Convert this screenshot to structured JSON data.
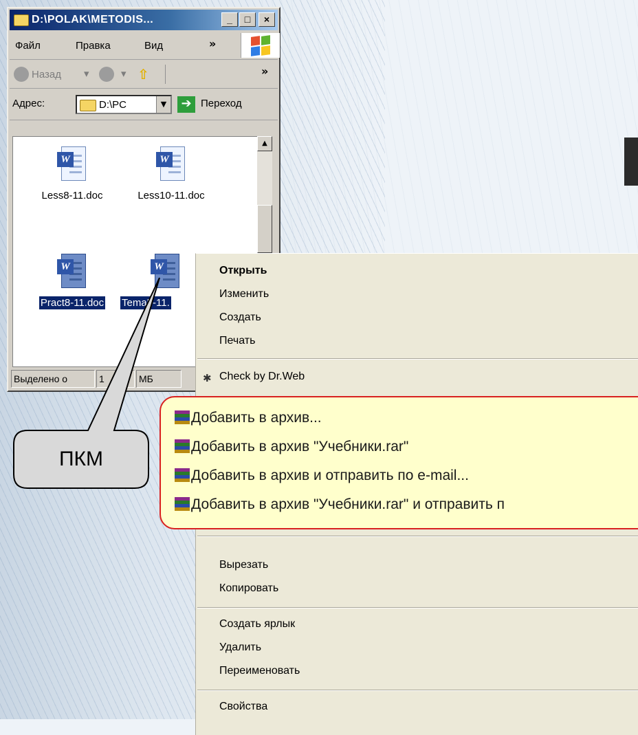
{
  "window": {
    "title": "D:\\POLAK\\METODIS...",
    "menu": [
      "Файл",
      "Правка",
      "Вид"
    ],
    "menu_more": "»",
    "toolbar_back": "Назад",
    "toolbar_more": "»",
    "address_label": "Адрес:",
    "address_value": "D:\\PC",
    "go_label": "Переход",
    "files": [
      {
        "name": "Less8-11.doc",
        "selected": false
      },
      {
        "name": "Less10-11.doc",
        "selected": false
      },
      {
        "name": "Pract8-11.doc",
        "selected": true
      },
      {
        "name": "Tema5-11.",
        "selected": true
      }
    ],
    "status_selected": "Выделено о",
    "status_size_partial": "1",
    "status_size_unit": "МБ",
    "minimize": "_",
    "maximize": "□",
    "close": "×"
  },
  "context_menu": {
    "items_top": [
      "Открыть",
      "Изменить",
      "Создать",
      "Печать"
    ],
    "drweb": "Check by Dr.Web",
    "rar_items": [
      "Добавить в архив...",
      "Добавить в архив \"Учебники.rar\"",
      "Добавить в архив и отправить по e-mail...",
      "Добавить в архив \"Учебники.rar\" и отправить п"
    ],
    "items_edit": [
      "Вырезать",
      "Копировать"
    ],
    "items_file": [
      "Создать ярлык",
      "Удалить",
      "Переименовать"
    ],
    "properties": "Свойства"
  },
  "callout": {
    "label": "ПКМ"
  },
  "colors": {
    "highlight_fill": "#ffffcc",
    "highlight_border": "#d82020",
    "selection": "#0a246a"
  }
}
